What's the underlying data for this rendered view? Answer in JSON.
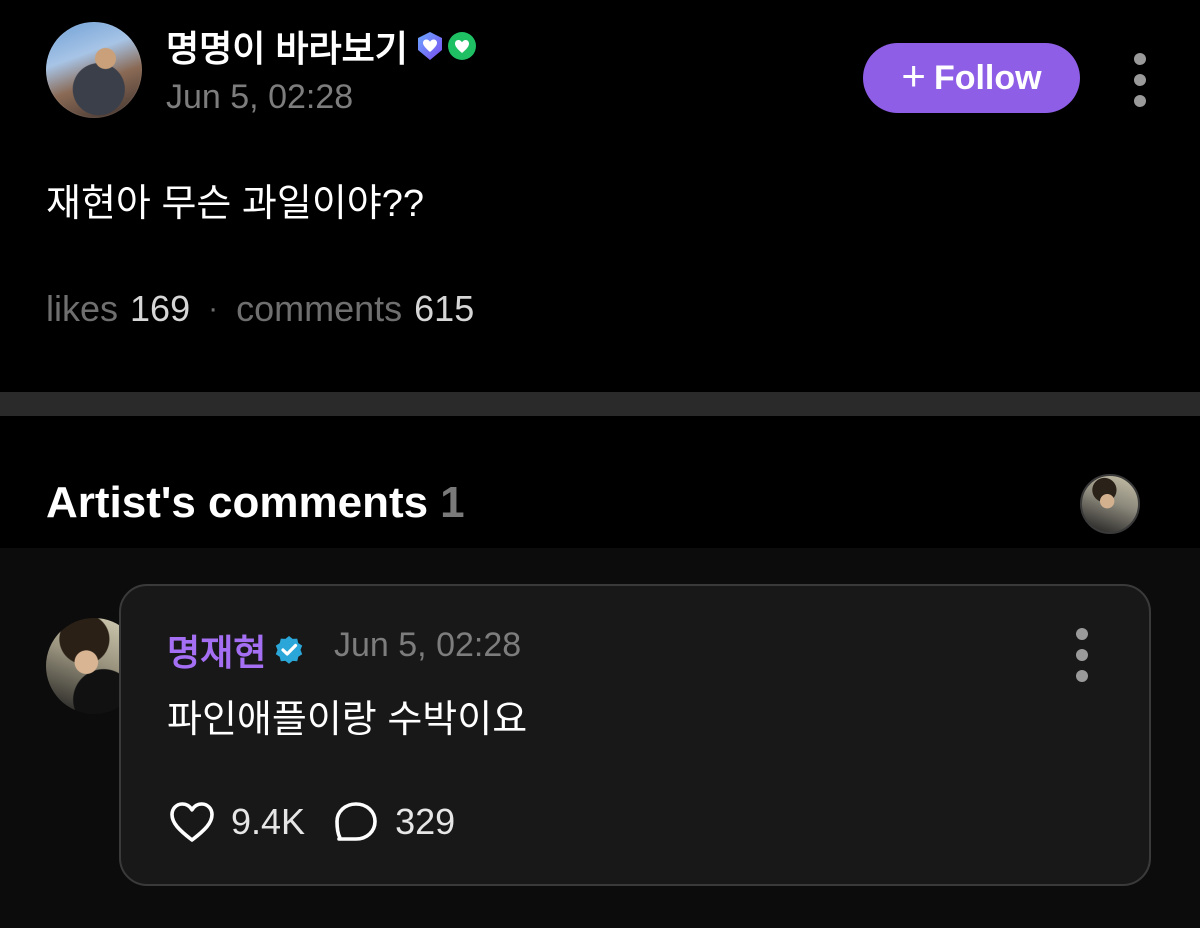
{
  "post": {
    "author": "명명이 바라보기",
    "time": "Jun 5, 02:28",
    "follow_label": "Follow",
    "text": "재현아 무슨 과일이야??",
    "likes_label": "likes",
    "likes_count": "169",
    "separator": "·",
    "comments_label": "comments",
    "comments_count": "615"
  },
  "artist_comments": {
    "title": "Artist's comments",
    "count": "1"
  },
  "comment": {
    "author": "명재현",
    "time": "Jun 5, 02:28",
    "text": "파인애플이랑 수박이요",
    "likes": "9.4K",
    "replies": "329"
  },
  "colors": {
    "background": "#000000",
    "accent_purple": "#8e5fe6",
    "artist_name": "#a46ff2",
    "badge_blue": "#5b6cf0",
    "badge_green": "#1fbf64",
    "verified_teal": "#2aa7d8",
    "muted_text": "#7d7d7d"
  },
  "icons": {
    "post_badges": [
      "heart-shield-badge-icon",
      "heart-circle-badge-icon"
    ],
    "follow": "plus-icon",
    "menu": "more-vertical-icon",
    "verified": "verified-badge-icon",
    "like": "heart-outline-icon",
    "reply": "speech-bubble-icon"
  }
}
